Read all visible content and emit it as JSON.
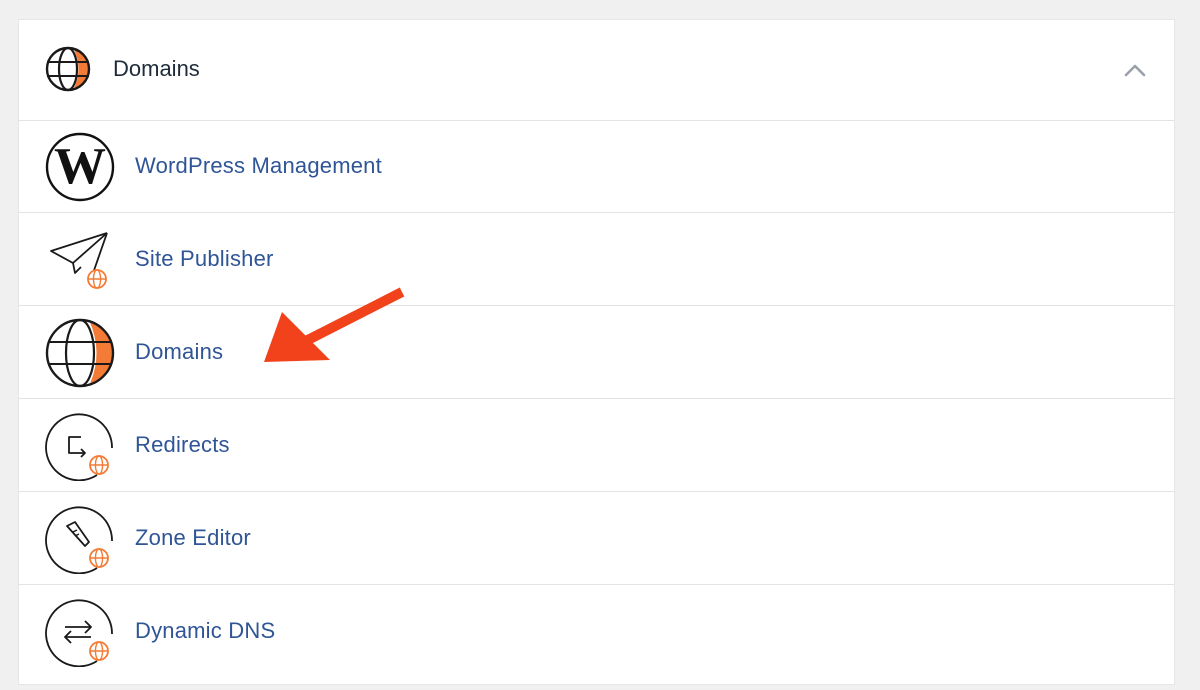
{
  "header": {
    "title": "Domains",
    "icon": "globe-icon",
    "collapse_icon": "chevron-up-icon"
  },
  "items": [
    {
      "label": "WordPress Management",
      "icon": "wordpress-icon"
    },
    {
      "label": "Site Publisher",
      "icon": "paper-plane-icon"
    },
    {
      "label": "Domains",
      "icon": "globe-icon"
    },
    {
      "label": "Redirects",
      "icon": "redirect-icon"
    },
    {
      "label": "Zone Editor",
      "icon": "pen-nib-icon"
    },
    {
      "label": "Dynamic DNS",
      "icon": "swap-arrows-icon"
    }
  ],
  "annotation": {
    "icon": "red-arrow-icon",
    "color": "#f2421b"
  },
  "colors": {
    "accent": "#f47b35",
    "link": "#2f5596",
    "text": "#1e2b3a"
  }
}
